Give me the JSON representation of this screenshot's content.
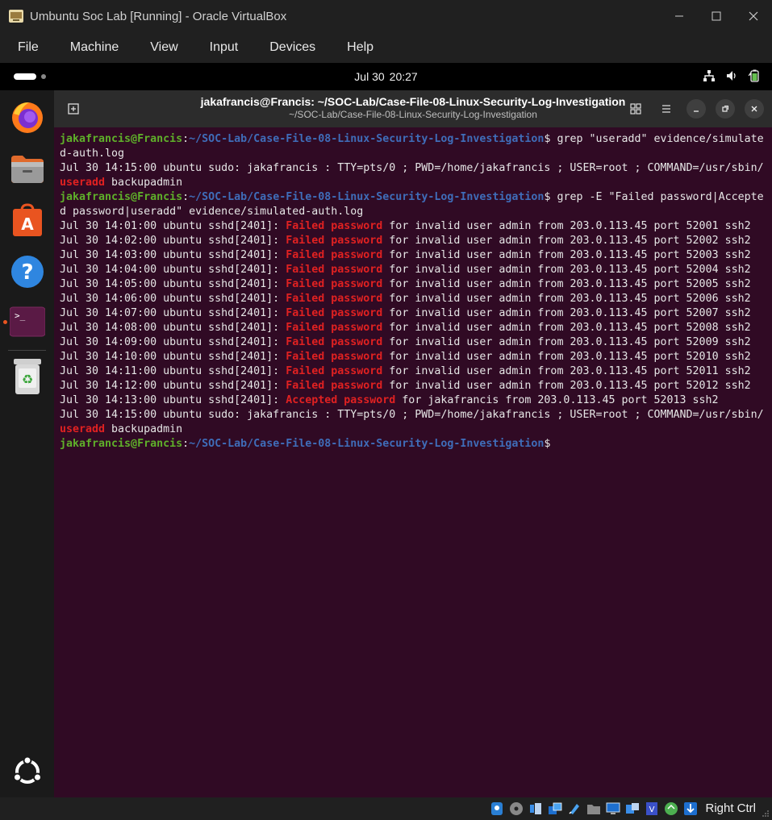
{
  "window": {
    "title": "Umbuntu Soc Lab [Running] - Oracle VirtualBox",
    "menu": [
      "File",
      "Machine",
      "View",
      "Input",
      "Devices",
      "Help"
    ]
  },
  "topbar": {
    "date": "Jul 30",
    "time": "20:27"
  },
  "dock": {
    "items": [
      "firefox-icon",
      "files-icon",
      "app-center-icon",
      "help-icon",
      "terminal-icon",
      "trash-icon",
      "show-apps-icon"
    ]
  },
  "terminal": {
    "title": "jakafrancis@Francis: ~/SOC-Lab/Case-File-08-Linux-Security-Log-Investigation",
    "subtitle": "~/SOC-Lab/Case-File-08-Linux-Security-Log-Investigation",
    "lines": [
      [
        {
          "t": "jakafrancis@Francis",
          "c": "user"
        },
        {
          "t": ":"
        },
        {
          "t": "~/SOC-Lab/Case-File-08-Linux-Security-Log-Investigation",
          "c": "path"
        },
        {
          "t": "$ grep \"useradd\" evidence/simulate"
        }
      ],
      [
        {
          "t": "d-auth.log"
        }
      ],
      [
        {
          "t": "Jul 30 14:15:00 ubuntu sudo: jakafrancis : TTY=pts/0 ; PWD=/home/jakafrancis ; USER=root ; COMMAND=/usr/sbin/"
        }
      ],
      [
        {
          "t": "useradd",
          "c": "red"
        },
        {
          "t": " backupadmin"
        }
      ],
      [
        {
          "t": "jakafrancis@Francis",
          "c": "user"
        },
        {
          "t": ":"
        },
        {
          "t": "~/SOC-Lab/Case-File-08-Linux-Security-Log-Investigation",
          "c": "path"
        },
        {
          "t": "$ grep -E \"Failed password|Accepte"
        }
      ],
      [
        {
          "t": "d password|useradd\" evidence/simulated-auth.log"
        }
      ],
      [
        {
          "t": "Jul 30 14:01:00 ubuntu sshd[2401]: "
        },
        {
          "t": "Failed password",
          "c": "red"
        },
        {
          "t": " for invalid user admin from 203.0.113.45 port 52001 ssh2"
        }
      ],
      [
        {
          "t": "Jul 30 14:02:00 ubuntu sshd[2401]: "
        },
        {
          "t": "Failed password",
          "c": "red"
        },
        {
          "t": " for invalid user admin from 203.0.113.45 port 52002 ssh2"
        }
      ],
      [
        {
          "t": "Jul 30 14:03:00 ubuntu sshd[2401]: "
        },
        {
          "t": "Failed password",
          "c": "red"
        },
        {
          "t": " for invalid user admin from 203.0.113.45 port 52003 ssh2"
        }
      ],
      [
        {
          "t": "Jul 30 14:04:00 ubuntu sshd[2401]: "
        },
        {
          "t": "Failed password",
          "c": "red"
        },
        {
          "t": " for invalid user admin from 203.0.113.45 port 52004 ssh2"
        }
      ],
      [
        {
          "t": "Jul 30 14:05:00 ubuntu sshd[2401]: "
        },
        {
          "t": "Failed password",
          "c": "red"
        },
        {
          "t": " for invalid user admin from 203.0.113.45 port 52005 ssh2"
        }
      ],
      [
        {
          "t": "Jul 30 14:06:00 ubuntu sshd[2401]: "
        },
        {
          "t": "Failed password",
          "c": "red"
        },
        {
          "t": " for invalid user admin from 203.0.113.45 port 52006 ssh2"
        }
      ],
      [
        {
          "t": "Jul 30 14:07:00 ubuntu sshd[2401]: "
        },
        {
          "t": "Failed password",
          "c": "red"
        },
        {
          "t": " for invalid user admin from 203.0.113.45 port 52007 ssh2"
        }
      ],
      [
        {
          "t": "Jul 30 14:08:00 ubuntu sshd[2401]: "
        },
        {
          "t": "Failed password",
          "c": "red"
        },
        {
          "t": " for invalid user admin from 203.0.113.45 port 52008 ssh2"
        }
      ],
      [
        {
          "t": "Jul 30 14:09:00 ubuntu sshd[2401]: "
        },
        {
          "t": "Failed password",
          "c": "red"
        },
        {
          "t": " for invalid user admin from 203.0.113.45 port 52009 ssh2"
        }
      ],
      [
        {
          "t": "Jul 30 14:10:00 ubuntu sshd[2401]: "
        },
        {
          "t": "Failed password",
          "c": "red"
        },
        {
          "t": " for invalid user admin from 203.0.113.45 port 52010 ssh2"
        }
      ],
      [
        {
          "t": "Jul 30 14:11:00 ubuntu sshd[2401]: "
        },
        {
          "t": "Failed password",
          "c": "red"
        },
        {
          "t": " for invalid user admin from 203.0.113.45 port 52011 ssh2"
        }
      ],
      [
        {
          "t": "Jul 30 14:12:00 ubuntu sshd[2401]: "
        },
        {
          "t": "Failed password",
          "c": "red"
        },
        {
          "t": " for invalid user admin from 203.0.113.45 port 52012 ssh2"
        }
      ],
      [
        {
          "t": "Jul 30 14:13:00 ubuntu sshd[2401]: "
        },
        {
          "t": "Accepted password",
          "c": "red"
        },
        {
          "t": " for jakafrancis from 203.0.113.45 port 52013 ssh2"
        }
      ],
      [
        {
          "t": "Jul 30 14:15:00 ubuntu sudo: jakafrancis : TTY=pts/0 ; PWD=/home/jakafrancis ; USER=root ; COMMAND=/usr/sbin/"
        }
      ],
      [
        {
          "t": "useradd",
          "c": "red"
        },
        {
          "t": " backupadmin"
        }
      ],
      [
        {
          "t": "jakafrancis@Francis",
          "c": "user"
        },
        {
          "t": ":"
        },
        {
          "t": "~/SOC-Lab/Case-File-08-Linux-Security-Log-Investigation",
          "c": "path"
        },
        {
          "t": "$"
        }
      ]
    ]
  },
  "statusbar": {
    "host_key": "Right Ctrl"
  },
  "colors": {
    "terminal_bg": "#300a24",
    "prompt_user": "#5fb02a",
    "prompt_path": "#3f6db9",
    "match_highlight": "#e02121",
    "ubuntu_accent": "#e95420"
  }
}
